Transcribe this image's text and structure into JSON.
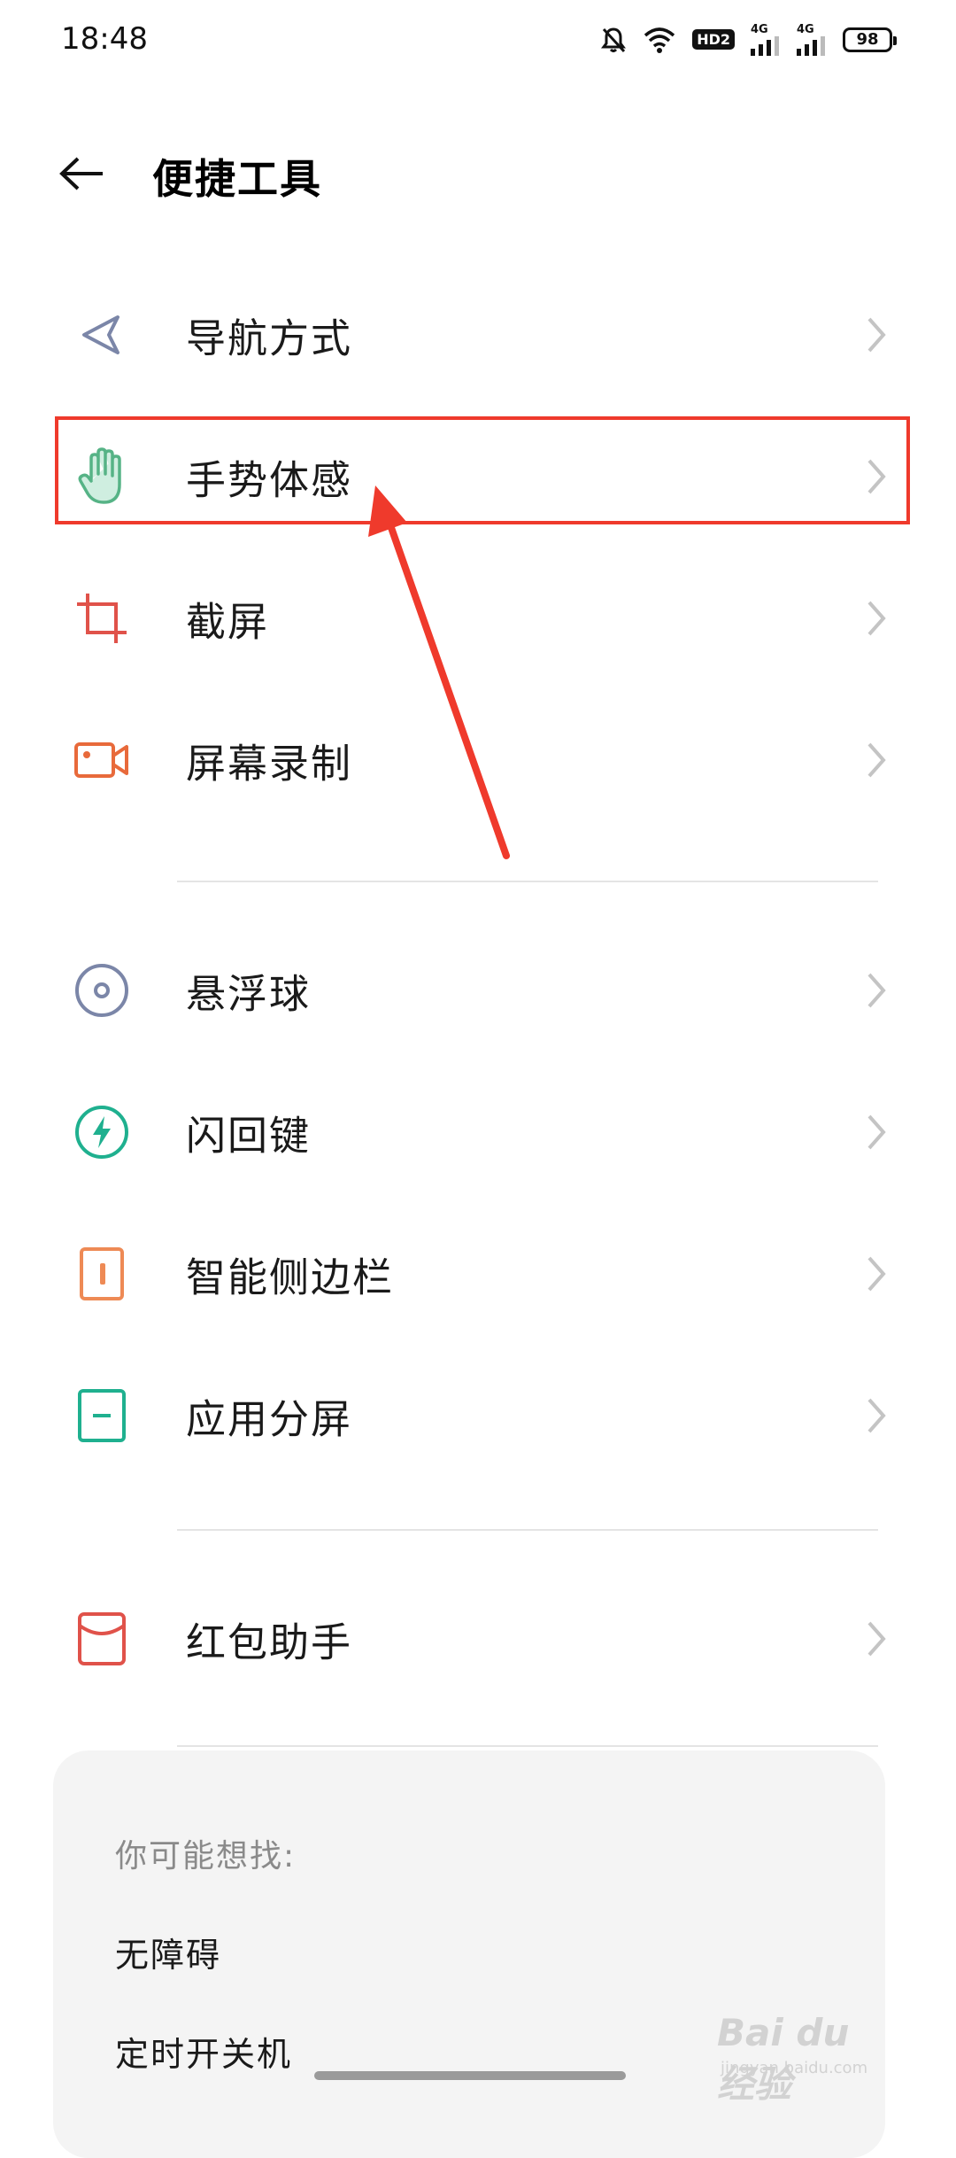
{
  "status_bar": {
    "time": "18:48",
    "hd_label": "HD2",
    "net1_label": "4G",
    "net2_label": "4G",
    "battery_level": "98"
  },
  "header": {
    "title": "便捷工具",
    "back_icon": "arrow-left-icon"
  },
  "sections": [
    {
      "items": [
        {
          "label": "导航方式",
          "icon": "navigation-icon",
          "color": "#7b86a8"
        },
        {
          "label": "手势体感",
          "icon": "hand-gesture-icon",
          "color": "#56b386"
        },
        {
          "label": "截屏",
          "icon": "crop-screenshot-icon",
          "color": "#e0524a"
        },
        {
          "label": "屏幕录制",
          "icon": "screen-record-icon",
          "color": "#e86a3b"
        }
      ]
    },
    {
      "items": [
        {
          "label": "悬浮球",
          "icon": "floating-ball-icon",
          "color": "#7b86a8"
        },
        {
          "label": "闪回键",
          "icon": "flashback-key-icon",
          "color": "#1fb08f"
        },
        {
          "label": "智能侧边栏",
          "icon": "smart-sidebar-icon",
          "color": "#ee8a55"
        },
        {
          "label": "应用分屏",
          "icon": "split-screen-icon",
          "color": "#1fb08f"
        }
      ]
    },
    {
      "items": [
        {
          "label": "红包助手",
          "icon": "red-envelope-icon",
          "color": "#e0524a"
        }
      ]
    }
  ],
  "suggestions": {
    "heading": "你可能想找:",
    "items": [
      "无障碍",
      "定时开关机"
    ]
  },
  "watermark": {
    "main": "Bai du 经验",
    "sub": "jingyan.baidu.com"
  },
  "colors": {
    "annotation": "#ef3a2c",
    "chevron": "#c4c4c4",
    "divider": "#e4e4e4"
  }
}
